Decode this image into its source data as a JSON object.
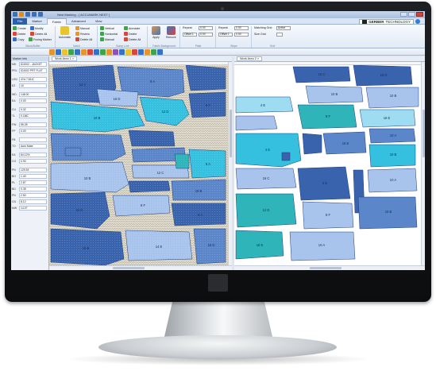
{
  "window": {
    "title": "Nest Marking - [ ACCUMARK NEST ]"
  },
  "menu_tabs": [
    "File",
    "Marker",
    "Fabric",
    "Advanced",
    "View"
  ],
  "active_tab": "Fabric",
  "brand": {
    "name": "GERBER",
    "suffix": "TECHNOLOGY"
  },
  "ribbon": {
    "block_buffer": {
      "group_label": "Block/Buffer",
      "create": "Create",
      "modify": "Modify",
      "delete": "Delete",
      "delete_all": "Delete All",
      "copy": "Copy",
      "fusing_marker": "Fusing Marker"
    },
    "notch": {
      "group_label": "Notch",
      "automatic": "Automatic",
      "manual": "Manual",
      "review": "Review",
      "delete_all": "Delete All"
    },
    "bump_line": {
      "group_label": "Bump Line",
      "vertical": "Vertical",
      "horizontal": "Horizontal",
      "manual": "Manual",
      "annotate": "Annotate",
      "delete": "Delete",
      "delete_all": "Delete All"
    },
    "fabric_background": {
      "group_label": "Fabric Background",
      "apply": "Apply",
      "remove": "Remove"
    },
    "plaid": {
      "group_label": "Plaid",
      "repeat_label": "Repeat",
      "repeat1_value": "0.00",
      "offset1_value": "Offset 1",
      "offset1_num": "0.00",
      "repeat2_label": "Repeat",
      "repeat2_value": "0.00",
      "offset2_value": "Offset 1",
      "offset2_num": "0.00"
    },
    "stripe": {
      "group_label": "Stripe"
    },
    "grid": {
      "group_label": "Grid",
      "matching_grid_label": "Matching Grid",
      "matching_grid_value": "Active",
      "size_grid_label": "Size Grid"
    }
  },
  "left_panel": {
    "header": "Marker Info",
    "rows": [
      {
        "key": "MD",
        "value": "ID1002 - JACKET"
      },
      {
        "key": "PRL",
        "value": "ID1002 PRT FLAT"
      },
      {
        "key": "LEN",
        "value": "4Yd 7.81IC"
      },
      {
        "key": "EZ",
        "value": "10"
      },
      {
        "key": "WD",
        "value": "148.00"
      },
      {
        "key": "EA",
        "value": "0.00"
      },
      {
        "key": "CU",
        "value": "0.32"
      },
      {
        "key": "TL",
        "value": "0.18IC"
      },
      {
        "key": "FW",
        "value": "55.28"
      },
      {
        "key": "FP",
        "value": "0.00"
      },
      {
        "key": "FB",
        "value": ""
      },
      {
        "key": "TO",
        "value": "Auto Mate"
      },
      {
        "key": "EA",
        "value": "84.12%"
      },
      {
        "key": "CO",
        "value": "0.90"
      },
      {
        "key": "PN",
        "value": "129.53"
      },
      {
        "key": "BO",
        "value": "1.40"
      },
      {
        "key": "PL",
        "value": "2.87"
      },
      {
        "key": "BD",
        "value": "0.35"
      },
      {
        "key": "PN",
        "value": "2.50"
      },
      {
        "key": "CN",
        "value": "8.12"
      },
      {
        "key": "MW",
        "value": "14.07"
      }
    ]
  },
  "work_areas": [
    {
      "tab": "Work Area 1",
      "close": "×"
    },
    {
      "tab": "Work Area 2",
      "close": "×"
    }
  ],
  "colors": {
    "dark_blue": "#3a63ad",
    "medium_blue": "#5b86c9",
    "light_blue": "#a9c4ec",
    "cyan": "#36c0e0",
    "light_cyan": "#9ddcf1",
    "teal": "#2fb5b9",
    "fabric_pattern": "#d7d2c2"
  },
  "work_area1_labels": [
    "12 C",
    "6 A",
    "16 D",
    "10 B",
    "12 D",
    "8 F",
    "6 A",
    "10 B",
    "12 C",
    "6 A",
    "10 B",
    "12 D",
    "8 F",
    "6 A",
    "10 B",
    "14 E",
    "16 D"
  ],
  "work_area2_labels": [
    "16 C",
    "16 D",
    "10 B",
    "10 B",
    "4 E",
    "8 F",
    "16 E",
    "10 A",
    "4 E",
    "16 E",
    "10 B",
    "16 C",
    "4 E",
    "10 A",
    "12 D",
    "8 F",
    "10 B",
    "16 E",
    "10 A"
  ]
}
